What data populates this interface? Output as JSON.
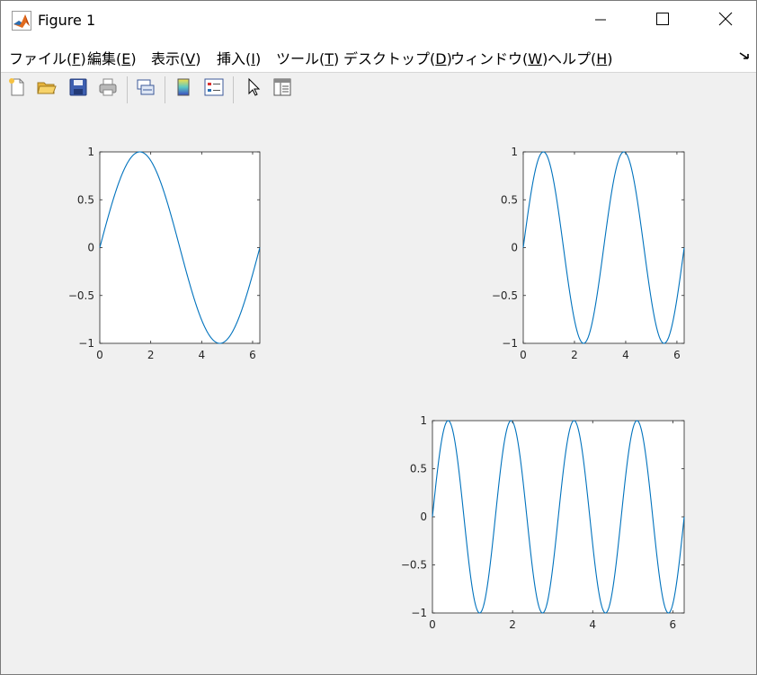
{
  "window": {
    "title": "Figure 1",
    "icons": {
      "app": "matlab-logo-icon",
      "minimize": "minimize-icon",
      "maximize": "maximize-icon",
      "close": "close-icon"
    }
  },
  "menubar": {
    "items": [
      {
        "label": "ファイル(",
        "key": "F",
        "suffix": ")"
      },
      {
        "label": "編集(",
        "key": "E",
        "suffix": ")"
      },
      {
        "label": "表示(",
        "key": "V",
        "suffix": ")"
      },
      {
        "label": "挿入(",
        "key": "I",
        "suffix": ")"
      },
      {
        "label": "ツール(",
        "key": "T",
        "suffix": ")"
      },
      {
        "label": "デスクトップ(",
        "key": "D",
        "suffix": ")"
      },
      {
        "label": "ウィンドウ(",
        "key": "W",
        "suffix": ")"
      },
      {
        "label": "ヘルプ(",
        "key": "H",
        "suffix": ")"
      }
    ],
    "overflow_icon": "dock-arrow-icon"
  },
  "toolbar": {
    "buttons": [
      {
        "icon": "new-figure-icon"
      },
      {
        "icon": "open-file-icon"
      },
      {
        "icon": "save-icon"
      },
      {
        "icon": "print-icon"
      },
      {
        "icon": "link-plot-icon"
      },
      {
        "icon": "insert-colorbar-icon"
      },
      {
        "icon": "insert-legend-icon"
      },
      {
        "icon": "edit-plot-cursor-icon"
      },
      {
        "icon": "property-inspector-icon"
      }
    ]
  },
  "colors": {
    "line": "#0072bd",
    "axes_bg": "#ffffff",
    "figure_bg": "#f0f0f0",
    "axis_color": "#262626"
  },
  "chart_data": [
    {
      "type": "line",
      "title": "",
      "xlabel": "",
      "ylabel": "",
      "function": "y = sin(x)",
      "x": [
        0,
        0.3142,
        0.6283,
        0.9425,
        1.2566,
        1.5708,
        1.885,
        2.1991,
        2.5133,
        2.8274,
        3.1416,
        3.4558,
        3.7699,
        4.0841,
        4.3982,
        4.7124,
        5.0265,
        5.3407,
        5.6549,
        5.969,
        6.2832
      ],
      "y": [
        0,
        0.309,
        0.5878,
        0.809,
        0.9511,
        1,
        0.9511,
        0.809,
        0.5878,
        0.309,
        0,
        -0.309,
        -0.5878,
        -0.809,
        -0.9511,
        -1,
        -0.9511,
        -0.809,
        -0.5878,
        -0.309,
        0
      ],
      "xlim": [
        0,
        6.2832
      ],
      "ylim": [
        -1,
        1
      ],
      "xticks": [
        0,
        2,
        4,
        6
      ],
      "xtick_labels": [
        "0",
        "2",
        "4",
        "6"
      ],
      "yticks": [
        -1,
        -0.5,
        0,
        0.5,
        1
      ],
      "ytick_labels": [
        "−1",
        "−0.5",
        "0",
        "0.5",
        "1"
      ],
      "grid": false,
      "legend": "none"
    },
    {
      "type": "line",
      "title": "",
      "xlabel": "",
      "ylabel": "",
      "function": "y = sin(2x)",
      "x": [
        0,
        0.3142,
        0.6283,
        0.9425,
        1.2566,
        1.5708,
        1.885,
        2.1991,
        2.5133,
        2.8274,
        3.1416,
        3.4558,
        3.7699,
        4.0841,
        4.3982,
        4.7124,
        5.0265,
        5.3407,
        5.6549,
        5.969,
        6.2832
      ],
      "y": [
        0,
        0.5878,
        0.9511,
        0.9511,
        0.5878,
        0,
        -0.5878,
        -0.9511,
        -0.9511,
        -0.5878,
        0,
        0.5878,
        0.9511,
        0.9511,
        0.5878,
        0,
        -0.5878,
        -0.9511,
        -0.9511,
        -0.5878,
        0
      ],
      "xlim": [
        0,
        6.2832
      ],
      "ylim": [
        -1,
        1
      ],
      "xticks": [
        0,
        2,
        4,
        6
      ],
      "xtick_labels": [
        "0",
        "2",
        "4",
        "6"
      ],
      "yticks": [
        -1,
        -0.5,
        0,
        0.5,
        1
      ],
      "ytick_labels": [
        "−1",
        "−0.5",
        "0",
        "0.5",
        "1"
      ],
      "grid": false,
      "legend": "none"
    },
    {
      "type": "line",
      "title": "",
      "xlabel": "",
      "ylabel": "",
      "function": "y = sin(4x)",
      "x": [
        0,
        0.3927,
        0.7854,
        1.1781,
        1.5708,
        1.9635,
        2.3562,
        2.7489,
        3.1416,
        3.5343,
        3.927,
        4.3197,
        4.7124,
        5.1051,
        5.4978,
        5.8905,
        6.2832
      ],
      "y": [
        0,
        1,
        0,
        -1,
        0,
        1,
        0,
        -1,
        0,
        1,
        0,
        -1,
        0,
        1,
        0,
        -1,
        0
      ],
      "xlim": [
        0,
        6.2832
      ],
      "ylim": [
        -1,
        1
      ],
      "xticks": [
        0,
        2,
        4,
        6
      ],
      "xtick_labels": [
        "0",
        "2",
        "4",
        "6"
      ],
      "yticks": [
        -1,
        -0.5,
        0,
        0.5,
        1
      ],
      "ytick_labels": [
        "−1",
        "−0.5",
        "0",
        "0.5",
        "1"
      ],
      "grid": false,
      "legend": "none"
    }
  ]
}
